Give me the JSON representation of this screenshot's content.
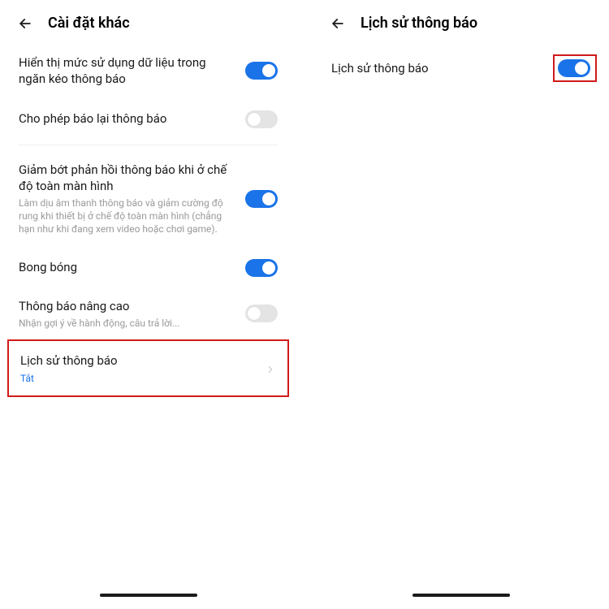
{
  "left": {
    "title": "Cài đặt khác",
    "items": {
      "data_usage": {
        "label": "Hiển thị mức sử dụng dữ liệu trong ngăn kéo thông báo",
        "on": true
      },
      "snooze": {
        "label": "Cho phép báo lại thông báo",
        "on": false
      },
      "fullscreen": {
        "label": "Giảm bớt phản hồi thông báo khi ở chế độ toàn màn hình",
        "sub": "Làm dịu âm thanh thông báo và giảm cường độ rung khi thiết bị ở chế độ toàn màn hình (chẳng hạn như khi đang xem video hoặc chơi game).",
        "on": true
      },
      "bubbles": {
        "label": "Bong bóng",
        "on": true
      },
      "enhanced": {
        "label": "Thông báo nâng cao",
        "sub": "Nhận gợi ý về hành động, câu trả lời...",
        "on": false
      },
      "history": {
        "label": "Lịch sử thông báo",
        "status": "Tắt"
      }
    }
  },
  "right": {
    "title": "Lịch sử thông báo",
    "history": {
      "label": "Lịch sử thông báo",
      "on": true
    }
  }
}
